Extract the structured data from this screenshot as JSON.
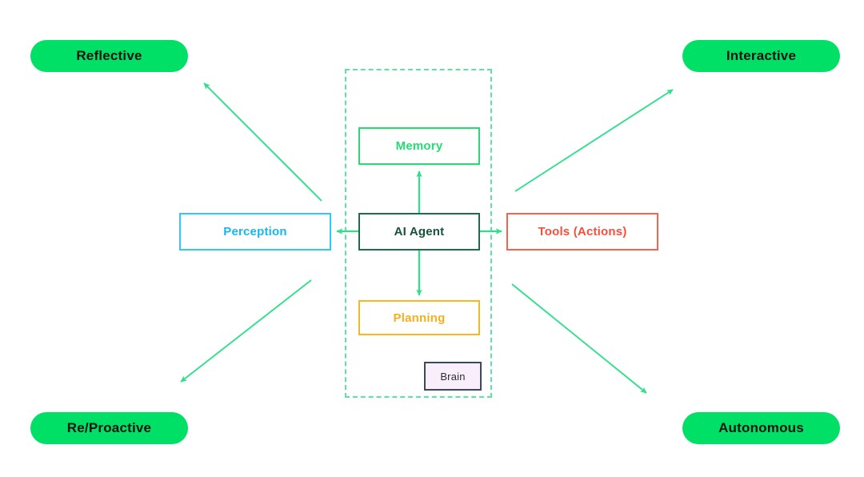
{
  "diagram": {
    "title": "AI Agent architecture with agent qualities",
    "background_color": "#ffffff",
    "accent_green": "#00e066",
    "arrow_color": "#2fe08b",
    "dashed_border_color": "#5fe3a1"
  },
  "pills": [
    {
      "id": "reflective",
      "label": "Reflective",
      "position": "top-left",
      "bg": "#00e066",
      "text_color": "#131313"
    },
    {
      "id": "interactive",
      "label": "Interactive",
      "position": "top-right",
      "bg": "#00e066",
      "text_color": "#131313"
    },
    {
      "id": "reproactive",
      "label": "Re/Proactive",
      "position": "bottom-left",
      "bg": "#00e066",
      "text_color": "#131313"
    },
    {
      "id": "autonomous",
      "label": "Autonomous",
      "position": "bottom-right",
      "bg": "#00e066",
      "text_color": "#131313"
    }
  ],
  "nodes": {
    "memory": {
      "label": "Memory",
      "border_color": "#24dd72",
      "text_color": "#24dd72"
    },
    "agent": {
      "label": "AI Agent",
      "border_color": "#1f6b4a",
      "text_color": "#15523a"
    },
    "planning": {
      "label": "Planning",
      "border_color": "#f6b81f",
      "text_color": "#f6b01f"
    },
    "perception": {
      "label": "Perception",
      "border_color": "#31c8f5",
      "text_color": "#17b7ee"
    },
    "tools": {
      "label": "Tools (Actions)",
      "border_color": "#f8614f",
      "text_color": "#f4503c"
    },
    "brain": {
      "label": "Brain",
      "border_color": "#3b4a5a",
      "text_color": "#2f2f35",
      "fill": "#f9eefc"
    }
  },
  "connections": [
    {
      "id": "agent-to-memory",
      "from": "agent",
      "to": "memory",
      "direction": "up",
      "color": "#2fe08b"
    },
    {
      "id": "agent-to-planning",
      "from": "agent",
      "to": "planning",
      "direction": "down",
      "color": "#2fe08b"
    },
    {
      "id": "agent-to-perception",
      "from": "agent",
      "to": "perception",
      "direction": "left",
      "color": "#2fe08b"
    },
    {
      "id": "agent-to-tools",
      "from": "agent",
      "to": "tools",
      "direction": "right",
      "color": "#2fe08b"
    },
    {
      "id": "core-to-reflective",
      "from": "core",
      "to": "reflective",
      "direction": "up-left",
      "color": "#2fe08b"
    },
    {
      "id": "core-to-interactive",
      "from": "core",
      "to": "interactive",
      "direction": "up-right",
      "color": "#2fe08b"
    },
    {
      "id": "core-to-reproactive",
      "from": "core",
      "to": "reproactive",
      "direction": "down-left",
      "color": "#2fe08b"
    },
    {
      "id": "core-to-autonomous",
      "from": "core",
      "to": "autonomous",
      "direction": "down-right",
      "color": "#2fe08b"
    }
  ]
}
